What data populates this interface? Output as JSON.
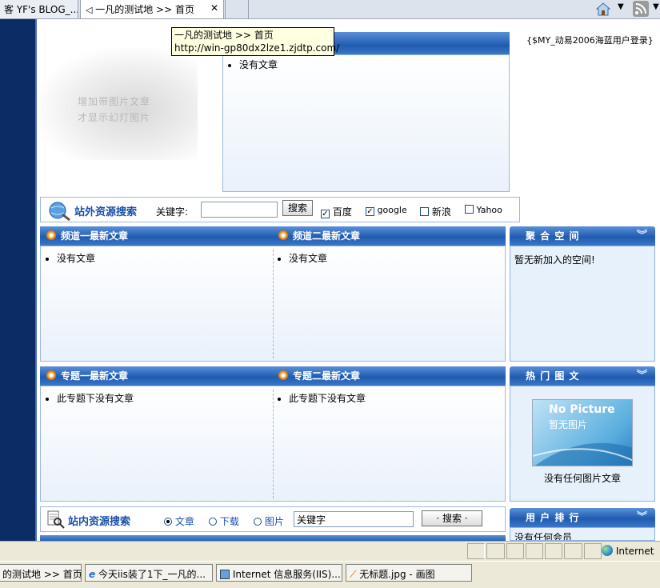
{
  "tabs": [
    {
      "label": "客 YF's BLOG_..."
    },
    {
      "label": "一凡的测试地 >> 首页",
      "close": "✕"
    }
  ],
  "tooltip": {
    "line1": "一凡的测试地 >> 首页",
    "line2": "http://win-gp80dx2lze1.zjdtp.com/"
  },
  "slideshow": {
    "line1": "增加带图片文章",
    "line2": "才显示幻灯图片"
  },
  "latest": {
    "item": "没有文章"
  },
  "login_text": "{$MY_动易2006海蓝用户登录}",
  "external_search": {
    "title": "站外资源搜索",
    "keyword_label": "关键字:",
    "button": "搜索",
    "options": [
      {
        "label": "百度",
        "checked": true
      },
      {
        "label": "google",
        "checked": true
      },
      {
        "label": "新浪",
        "checked": false
      },
      {
        "label": "Yahoo",
        "checked": false
      }
    ]
  },
  "channels": [
    {
      "title": "频道一最新文章",
      "item": "没有文章"
    },
    {
      "title": "频道二最新文章",
      "item": "没有文章"
    }
  ],
  "topics": [
    {
      "title": "专题一最新文章",
      "item": "此专题下没有文章"
    },
    {
      "title": "专题二最新文章",
      "item": "此专题下没有文章"
    }
  ],
  "space": {
    "title": "聚 合 空 间",
    "text": "暂无新加入的空间!"
  },
  "hot_images": {
    "title": "热 门 图 文",
    "nopic_en": "No Picture",
    "nopic_cn": "暂无图片",
    "text": "没有任何图片文章"
  },
  "user_rank": {
    "title": "用 户 排 行",
    "text": "没有任何会员"
  },
  "site_search": {
    "title": "站内资源搜索",
    "options": [
      {
        "label": "文章",
        "selected": true
      },
      {
        "label": "下载",
        "selected": false
      },
      {
        "label": "图片",
        "selected": false
      }
    ],
    "input_value": "关键字",
    "button": "· 搜索 ·"
  },
  "status": {
    "zone": "Internet"
  },
  "taskbar": [
    {
      "label": "的测试地 >> 首页..."
    },
    {
      "label": "今天iis装了1下_一凡的..."
    },
    {
      "label": "Internet 信息服务(IIS)..."
    },
    {
      "label": "无标题.jpg - 画图"
    }
  ],
  "colors": {
    "header_blue": "#1f5bb0",
    "left_bar": "#0c2c66",
    "panel_bg": "#f2f7fd",
    "link_blue": "#1a4fa8"
  },
  "icons": [
    "back-tab-icon",
    "close-icon",
    "home-icon",
    "dropdown-arrow-icon",
    "rss-icon",
    "sun-bullet-icon",
    "chevron-down-icon",
    "globe-search-icon",
    "document-search-icon",
    "internet-globe-icon",
    "ie-icon",
    "iis-icon",
    "paint-icon"
  ]
}
